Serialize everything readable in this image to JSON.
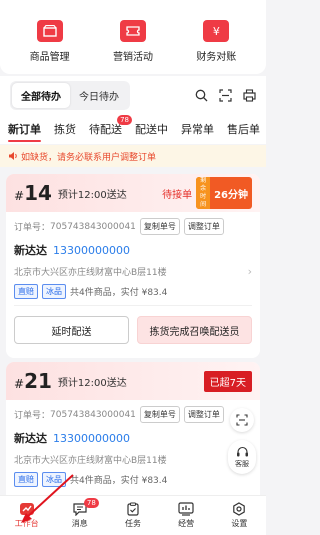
{
  "quick_entries": [
    {
      "label": "商品管理",
      "icon": "shop-icon"
    },
    {
      "label": "营销活动",
      "icon": "coupon-icon"
    },
    {
      "label": "财务对账",
      "icon": "yen-icon"
    }
  ],
  "filter": {
    "tabs": [
      "全部待办",
      "今日待办"
    ],
    "active": "全部待办"
  },
  "status_tabs": [
    {
      "label": "新订单",
      "active": true
    },
    {
      "label": "拣货"
    },
    {
      "label": "待配送",
      "badge": "78"
    },
    {
      "label": "配送中"
    },
    {
      "label": "异常单"
    },
    {
      "label": "售后单"
    }
  ],
  "notice": "如缺货，请务必联系用户调整订单",
  "orders": [
    {
      "number": "14",
      "eta": "预计12:00送达",
      "status": "待接单",
      "timer_small": "剩余时间",
      "timer": "26分钟",
      "order_label": "订单号：",
      "order_id": "705743843000041",
      "copy_btn": "复制单号",
      "adjust_btn": "调整订单",
      "customer": "新达达",
      "phone": "13300000000",
      "address": "北京市大兴区亦庄线财富中心B层11楼",
      "tags": [
        "直赔",
        "冰品"
      ],
      "summary": "共4件商品，实付 ¥83.4",
      "btn_delay": "延时配送",
      "btn_complete": "拣货完成召唤配送员"
    },
    {
      "number": "21",
      "eta": "预计12:00送达",
      "overdue": "已超7天",
      "order_label": "订单号：",
      "order_id": "705743843000041",
      "copy_btn": "复制单号",
      "adjust_btn": "调整订单",
      "customer": "新达达",
      "phone": "13300000000",
      "address": "北京市大兴区亦庄线财富中心B层11楼",
      "tags": [
        "直赔",
        "冰品"
      ],
      "summary": "共4件商品，实付 ¥83.4"
    }
  ],
  "floating": {
    "service_label": "客服"
  },
  "bottom_nav": [
    {
      "label": "工作台",
      "active": true
    },
    {
      "label": "消息",
      "badge": "78"
    },
    {
      "label": "任务"
    },
    {
      "label": "经营"
    },
    {
      "label": "设置"
    }
  ],
  "colors": {
    "accent": "#ef3b45",
    "phone": "#2b7de9"
  }
}
